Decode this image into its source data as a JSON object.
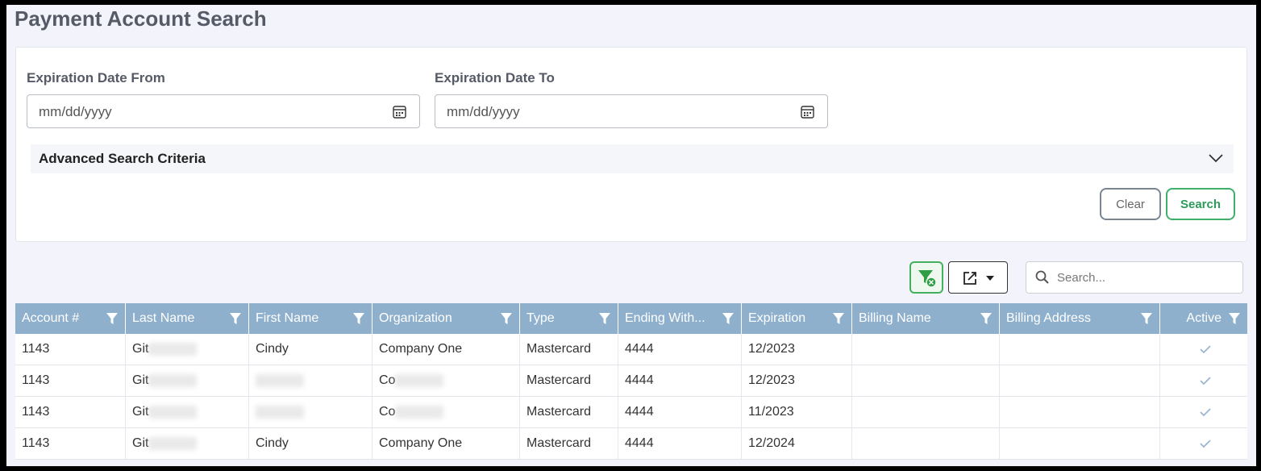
{
  "page_title": "Payment Account Search",
  "filters": {
    "exp_from_label": "Expiration Date From",
    "exp_from_placeholder": "mm/dd/yyyy",
    "exp_to_label": "Expiration Date To",
    "exp_to_placeholder": "mm/dd/yyyy",
    "advanced_label": "Advanced Search Criteria",
    "clear_label": "Clear",
    "search_label": "Search"
  },
  "toolbar": {
    "search_placeholder": "Search..."
  },
  "colors": {
    "header_bg": "#8fb0cd",
    "accent_green": "#3fb06a",
    "check_color": "#9bb6cf"
  },
  "table": {
    "columns": [
      {
        "label": "Account #",
        "w": 137
      },
      {
        "label": "Last Name",
        "w": 153
      },
      {
        "label": "First Name",
        "w": 153
      },
      {
        "label": "Organization",
        "w": 183
      },
      {
        "label": "Type",
        "w": 122
      },
      {
        "label": "Ending With...",
        "w": 153
      },
      {
        "label": "Expiration",
        "w": 137
      },
      {
        "label": "Billing Name",
        "w": 183
      },
      {
        "label": "Billing Address",
        "w": 199
      },
      {
        "label": "Active",
        "w": 108
      }
    ],
    "rows": [
      {
        "account": "1143",
        "last": "Git",
        "first": "Cindy",
        "org": "Company One",
        "type": "Mastercard",
        "ending": "4444",
        "exp": "12/2023",
        "billing_name": "",
        "billing_address": ""
      },
      {
        "account": "1143",
        "last": "Git",
        "first": "",
        "org": "Co",
        "type": "Mastercard",
        "ending": "4444",
        "exp": "12/2023",
        "billing_name": "",
        "billing_address": ""
      },
      {
        "account": "1143",
        "last": "Git",
        "first": "",
        "org": "Co",
        "type": "Mastercard",
        "ending": "4444",
        "exp": "11/2023",
        "billing_name": "",
        "billing_address": ""
      },
      {
        "account": "1143",
        "last": "Git",
        "first": "Cindy",
        "org": "Company One",
        "type": "Mastercard",
        "ending": "4444",
        "exp": "12/2024",
        "billing_name": "",
        "billing_address": ""
      }
    ]
  }
}
